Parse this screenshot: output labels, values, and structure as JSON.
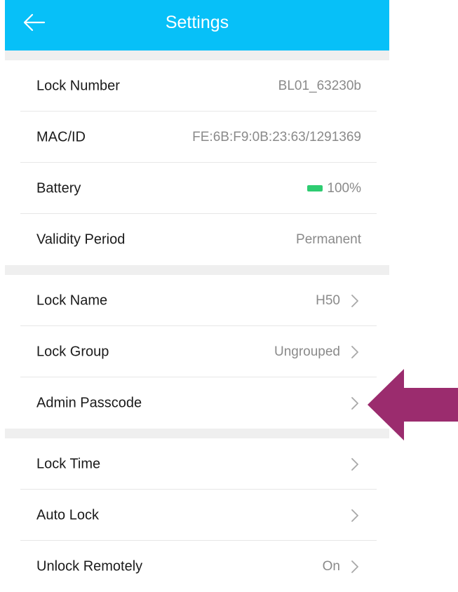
{
  "header": {
    "title": "Settings",
    "back_icon": "back-arrow-icon",
    "background_color": "#07c0f8"
  },
  "info_section": [
    {
      "label": "Lock Number",
      "value": "BL01_63230b"
    },
    {
      "label": "MAC/ID",
      "value": "FE:6B:F9:0B:23:63/1291369"
    },
    {
      "label": "Battery",
      "value": "100%",
      "level": 1.0,
      "icon": "battery-icon",
      "icon_color": "#2ecc71"
    },
    {
      "label": "Validity Period",
      "value": "Permanent"
    }
  ],
  "config_section": [
    {
      "label": "Lock Name",
      "value": "H50",
      "icon": "chevron-right-icon"
    },
    {
      "label": "Lock Group",
      "value": "Ungrouped",
      "icon": "chevron-right-icon"
    },
    {
      "label": "Admin Passcode",
      "value": "",
      "icon": "chevron-right-icon"
    }
  ],
  "time_section": [
    {
      "label": "Lock Time",
      "value": "",
      "icon": "chevron-right-icon"
    },
    {
      "label": "Auto Lock",
      "value": "",
      "icon": "chevron-right-icon"
    },
    {
      "label": "Unlock Remotely",
      "value": "On",
      "icon": "chevron-right-icon"
    }
  ],
  "annotation": {
    "icon": "pointer-arrow-icon",
    "color": "#9b2c6e"
  }
}
